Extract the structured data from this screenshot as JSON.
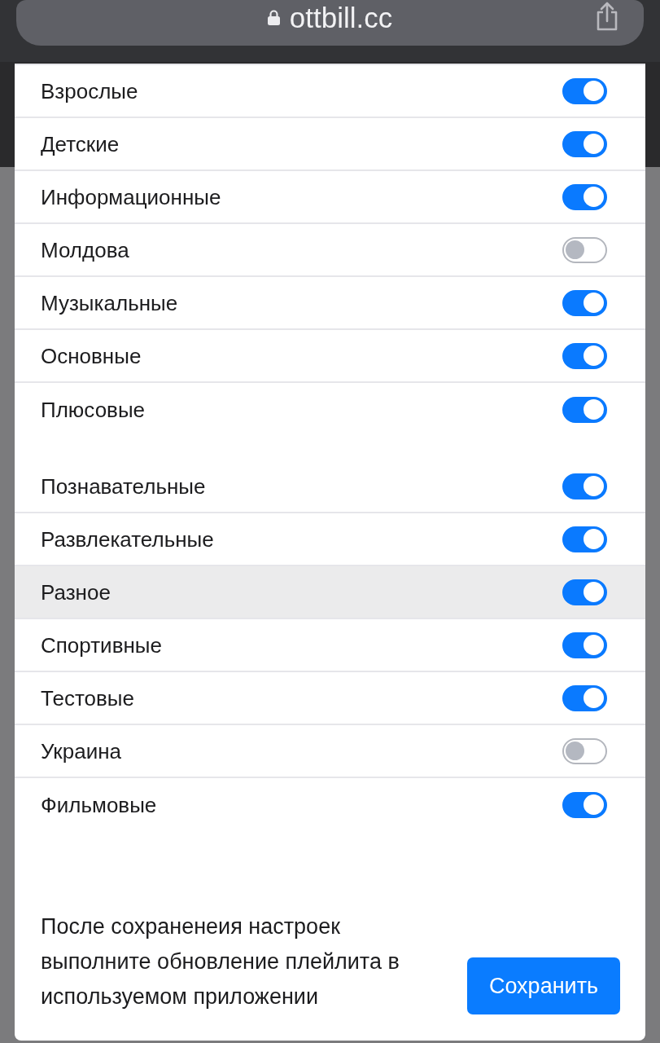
{
  "browser": {
    "url": "ottbill.cc"
  },
  "groups": [
    {
      "items": [
        {
          "label": "Взрослые",
          "on": true,
          "highlighted": false
        },
        {
          "label": "Детские",
          "on": true,
          "highlighted": false
        },
        {
          "label": "Информационные",
          "on": true,
          "highlighted": false
        },
        {
          "label": "Молдова",
          "on": false,
          "highlighted": false
        },
        {
          "label": "Музыкальные",
          "on": true,
          "highlighted": false
        },
        {
          "label": "Основные",
          "on": true,
          "highlighted": false
        },
        {
          "label": "Плюсовые",
          "on": true,
          "highlighted": false
        }
      ]
    },
    {
      "items": [
        {
          "label": "Познавательные",
          "on": true,
          "highlighted": false
        },
        {
          "label": "Развлекательные",
          "on": true,
          "highlighted": false
        },
        {
          "label": "Разное",
          "on": true,
          "highlighted": true
        },
        {
          "label": "Спортивные",
          "on": true,
          "highlighted": false
        },
        {
          "label": "Тестовые",
          "on": true,
          "highlighted": false
        },
        {
          "label": "Украина",
          "on": false,
          "highlighted": false
        },
        {
          "label": "Фильмовые",
          "on": true,
          "highlighted": false
        }
      ]
    }
  ],
  "footer": {
    "note": "После сохраненеия настроек выполните обновление плейлита в используемом приложении",
    "button": "Сохранить"
  }
}
